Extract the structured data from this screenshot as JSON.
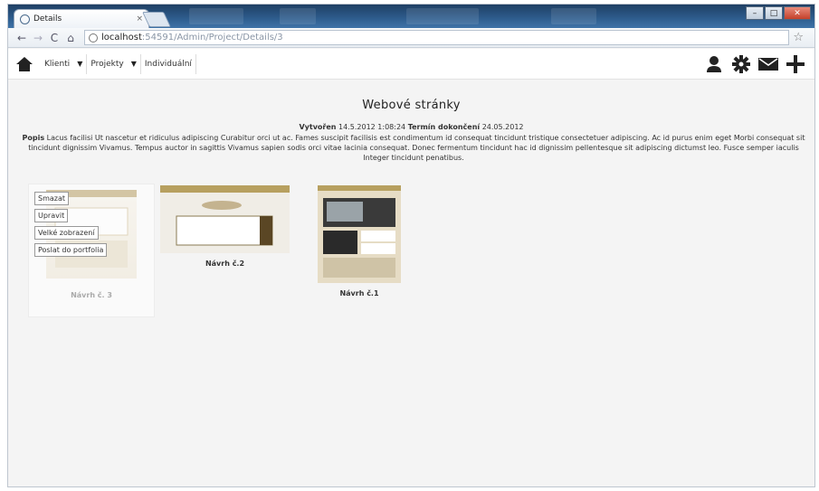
{
  "browser": {
    "tab_title": "Details",
    "tab_close": "×",
    "url_host": "localhost",
    "url_path": ":54591/Admin/Project/Details/3",
    "window_buttons": [
      "–",
      "□",
      "✕"
    ]
  },
  "nav": {
    "items": [
      {
        "label": "Klienti",
        "caret": "▼"
      },
      {
        "label": "Projekty",
        "caret": "▼"
      },
      {
        "label": "Individuální",
        "caret": ""
      }
    ],
    "icons": [
      "user-icon",
      "gear-icon",
      "mail-icon",
      "plus-icon"
    ]
  },
  "project": {
    "title": "Webové stránky",
    "created_label": "Vytvořen",
    "created_value": "14.5.2012 1:08:24",
    "deadline_label": "Termín dokončení",
    "deadline_value": "24.05.2012",
    "desc_label": "Popis",
    "desc_text": "Lacus facilisi Ut nascetur et ridiculus adipiscing Curabitur orci ut ac. Fames suscipit facilisis est condimentum id consequat tincidunt tristique consectetuer adipiscing. Ac id purus enim eget Morbi consequat sit tincidunt dignissim Vivamus. Tempus auctor in sagittis Vivamus sapien sodis orci vitae lacinia consequat. Donec fermentum tincidunt hac id dignissim pellentesque sit adipiscing dictumst leo. Fusce semper iaculis Integer tincidunt penatibus."
  },
  "designs": [
    {
      "caption": "Návrh č. 3",
      "actions": [
        "Smazat",
        "Upravit",
        "Velké zobrazení",
        "Poslat do portfolia"
      ]
    },
    {
      "caption": "Návrh č.2"
    },
    {
      "caption": "Návrh č.1"
    }
  ]
}
